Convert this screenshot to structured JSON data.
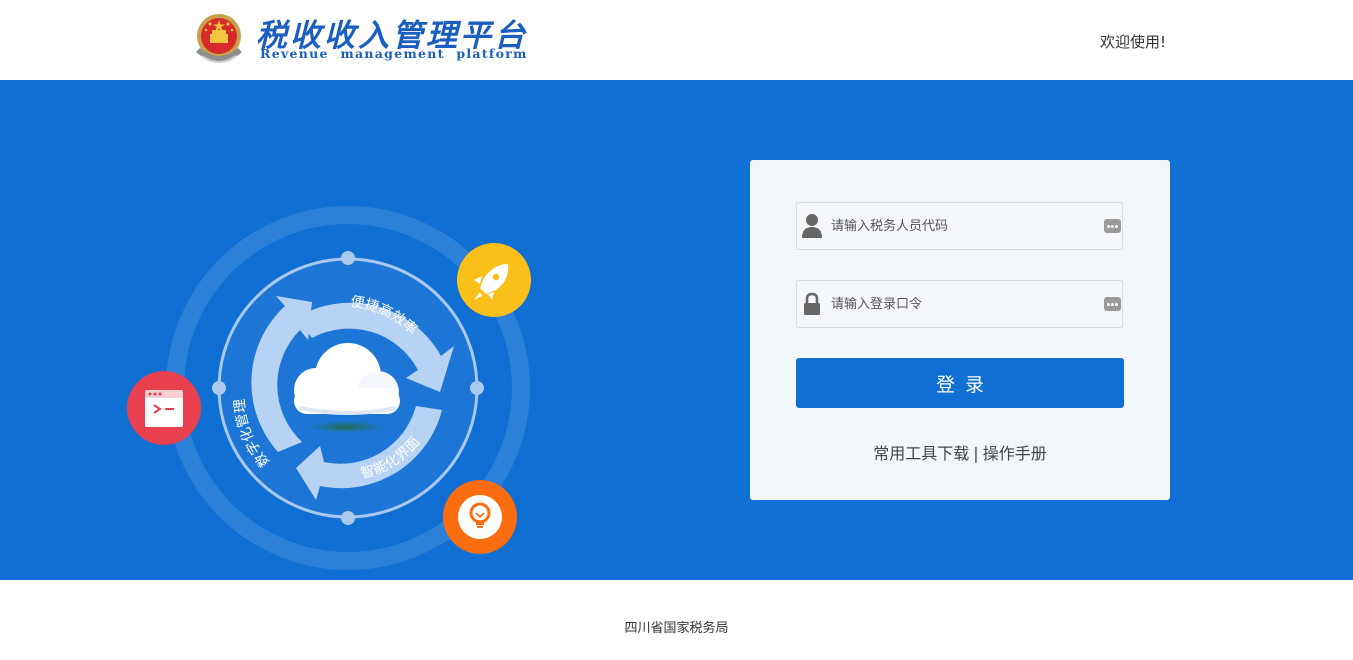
{
  "header": {
    "logo_title": "税收收入管理平台",
    "logo_subtitle": "Revenue management platform",
    "welcome": "欢迎使用!"
  },
  "illustration": {
    "ring_labels": {
      "top": "便捷高效率",
      "left": "数字化管理",
      "bottom": "智能化界面"
    },
    "icons": [
      "rocket-icon",
      "terminal-icon",
      "lightbulb-icon",
      "cloud-icon"
    ],
    "colors": {
      "rocket": "#fbbf19",
      "terminal": "#e8404f",
      "lightbulb": "#fb6d0e",
      "ring": "#a9c9ef"
    }
  },
  "login": {
    "username_placeholder": "请输入税务人员代码",
    "password_placeholder": "请输入登录口令",
    "submit_label": "登录",
    "tools_link": "常用工具下载",
    "separator": "|",
    "manual_link": "操作手册"
  },
  "footer": {
    "text": "四川省国家税务局"
  },
  "colors": {
    "primary": "#0f6fd3",
    "card_bg": "#f2f7fb"
  }
}
